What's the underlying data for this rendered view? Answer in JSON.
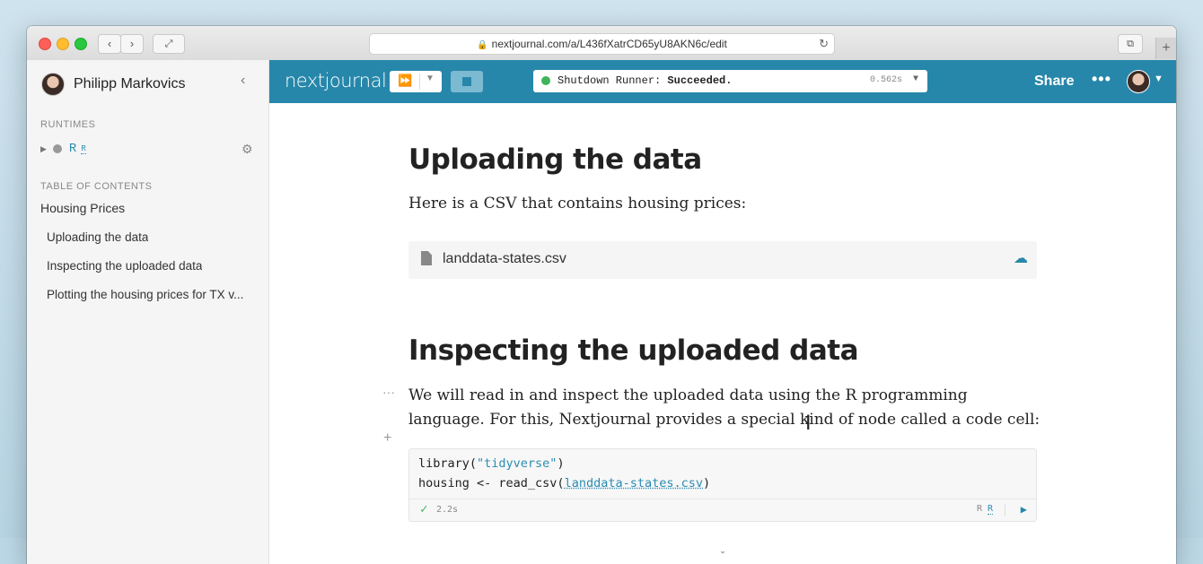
{
  "browser": {
    "url": "nextjournal.com/a/L436fXatrCD65yU8AKN6c/edit",
    "back_glyph": "‹",
    "forward_glyph": "›",
    "new_tab_glyph": "+"
  },
  "sidebar": {
    "user_name": "Philipp Markovics",
    "runtimes_label": "RUNTIMES",
    "runtime": {
      "name": "R",
      "badge": "R"
    },
    "toc_label": "TABLE OF CONTENTS",
    "toc": [
      "Housing Prices",
      "Uploading the data",
      "Inspecting the uploaded data",
      "Plotting the housing prices for TX v..."
    ]
  },
  "toolbar": {
    "logo": "nextjournal",
    "status_prefix": "Shutdown Runner:",
    "status_value": "Succeeded.",
    "status_time": "0.562s",
    "share_label": "Share",
    "more_label": "•••",
    "accent_color": "#2787aa"
  },
  "content": {
    "section1_title": "Uploading the data",
    "section1_text": "Here is a CSV that contains housing prices:",
    "file_name": "landdata-states.csv",
    "section2_title": "Inspecting the uploaded data",
    "section2_text": "We will read in and inspect the uploaded data using the R programming language. For this, Nextjournal provides a special kind of node called a code cell:",
    "cell_menu": "···",
    "add_cell": "+",
    "code": {
      "line1_fn": "library(",
      "line1_str": "\"tidyverse\"",
      "line1_end": ")",
      "line2_pre": "housing <- read_csv(",
      "line2_ref": "landdata-states.csv",
      "line2_end": ")",
      "duration": "2.2s",
      "lang": "R",
      "lang_badge": "R"
    }
  }
}
